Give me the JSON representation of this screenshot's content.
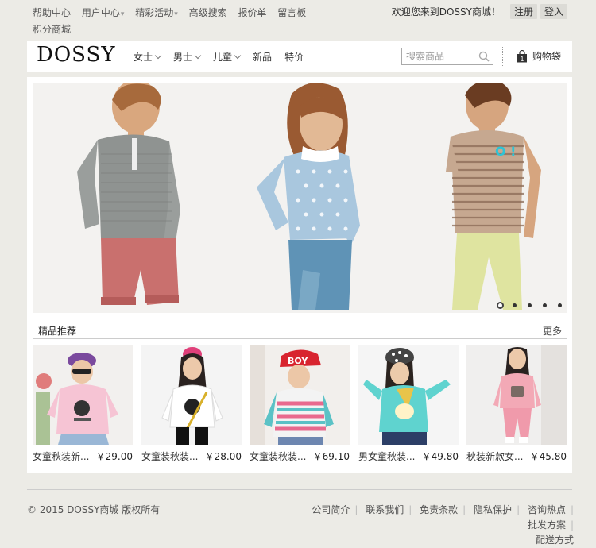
{
  "topbar": {
    "links": [
      {
        "label": "帮助中心",
        "dropdown": false
      },
      {
        "label": "用户中心",
        "dropdown": true
      },
      {
        "label": "精彩活动",
        "dropdown": true
      },
      {
        "label": "高级搜索",
        "dropdown": false
      },
      {
        "label": "报价单",
        "dropdown": false
      },
      {
        "label": "留言板",
        "dropdown": false
      },
      {
        "label": "积分商城",
        "dropdown": false
      }
    ],
    "welcome": "欢迎您来到DOSSY商城！",
    "register": "注册",
    "login": "登入"
  },
  "header": {
    "logo": "DOSSY",
    "nav": [
      {
        "label": "女士",
        "dropdown": true
      },
      {
        "label": "男士",
        "dropdown": true
      },
      {
        "label": "儿童",
        "dropdown": true
      },
      {
        "label": "新品",
        "dropdown": false
      },
      {
        "label": "特价",
        "dropdown": false
      }
    ],
    "search_placeholder": "搜索商品",
    "cart_label": "购物袋",
    "cart_count": "1"
  },
  "banner": {
    "slides_total": 5,
    "active_slide": 1
  },
  "recommend": {
    "title": "精品推荐",
    "more": "更多",
    "products": [
      {
        "name": "女童秋装新...",
        "price": "￥29.00"
      },
      {
        "name": "女童装秋装...",
        "price": "￥28.00"
      },
      {
        "name": "女童装秋装...",
        "price": "￥69.10"
      },
      {
        "name": "男女童秋装...",
        "price": "￥49.80"
      },
      {
        "name": "秋装新款女...",
        "price": "￥45.80"
      }
    ]
  },
  "footer": {
    "copyright": "© 2015 DOSSY商城 版权所有",
    "links": [
      "公司简介",
      "联系我们",
      "免责条款",
      "隐私保护",
      "咨询热点",
      "批发方案",
      "配送方式"
    ]
  },
  "colors": {
    "page_bg": "#ecebe6",
    "panel_bg": "#ffffff",
    "button_bg": "#dcdbd6",
    "accent_cyan": "#2ec4d6"
  }
}
